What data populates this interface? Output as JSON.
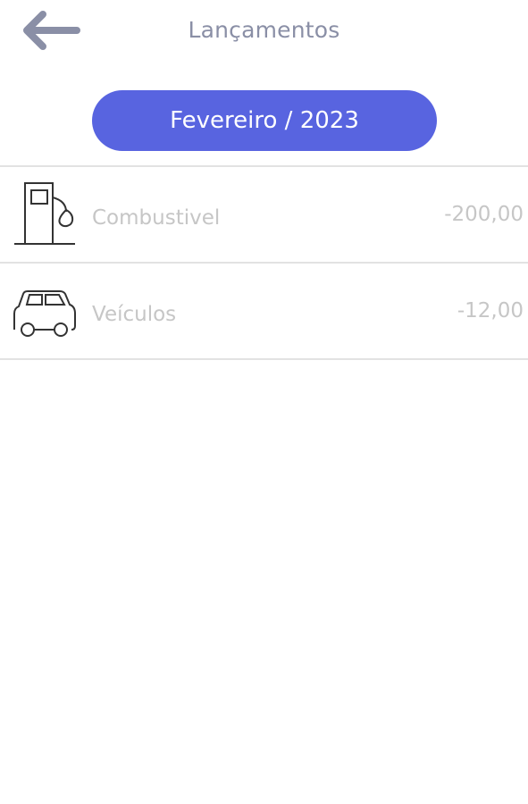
{
  "header": {
    "back_icon": "arrow-left-icon",
    "title": "Lançamentos"
  },
  "month_selector": {
    "label": "Fevereiro / 2023"
  },
  "entries": [
    {
      "label": "Combustivel",
      "value": "-200,00",
      "icon": "fuel-pump-icon"
    },
    {
      "label": "Veículos",
      "value": "-12,00",
      "icon": "car-icon"
    }
  ],
  "colors": {
    "accent": "#5864e0",
    "title_text": "#8a8fa6",
    "muted_text": "#c6c6c6",
    "divider": "#e2e2e2"
  }
}
